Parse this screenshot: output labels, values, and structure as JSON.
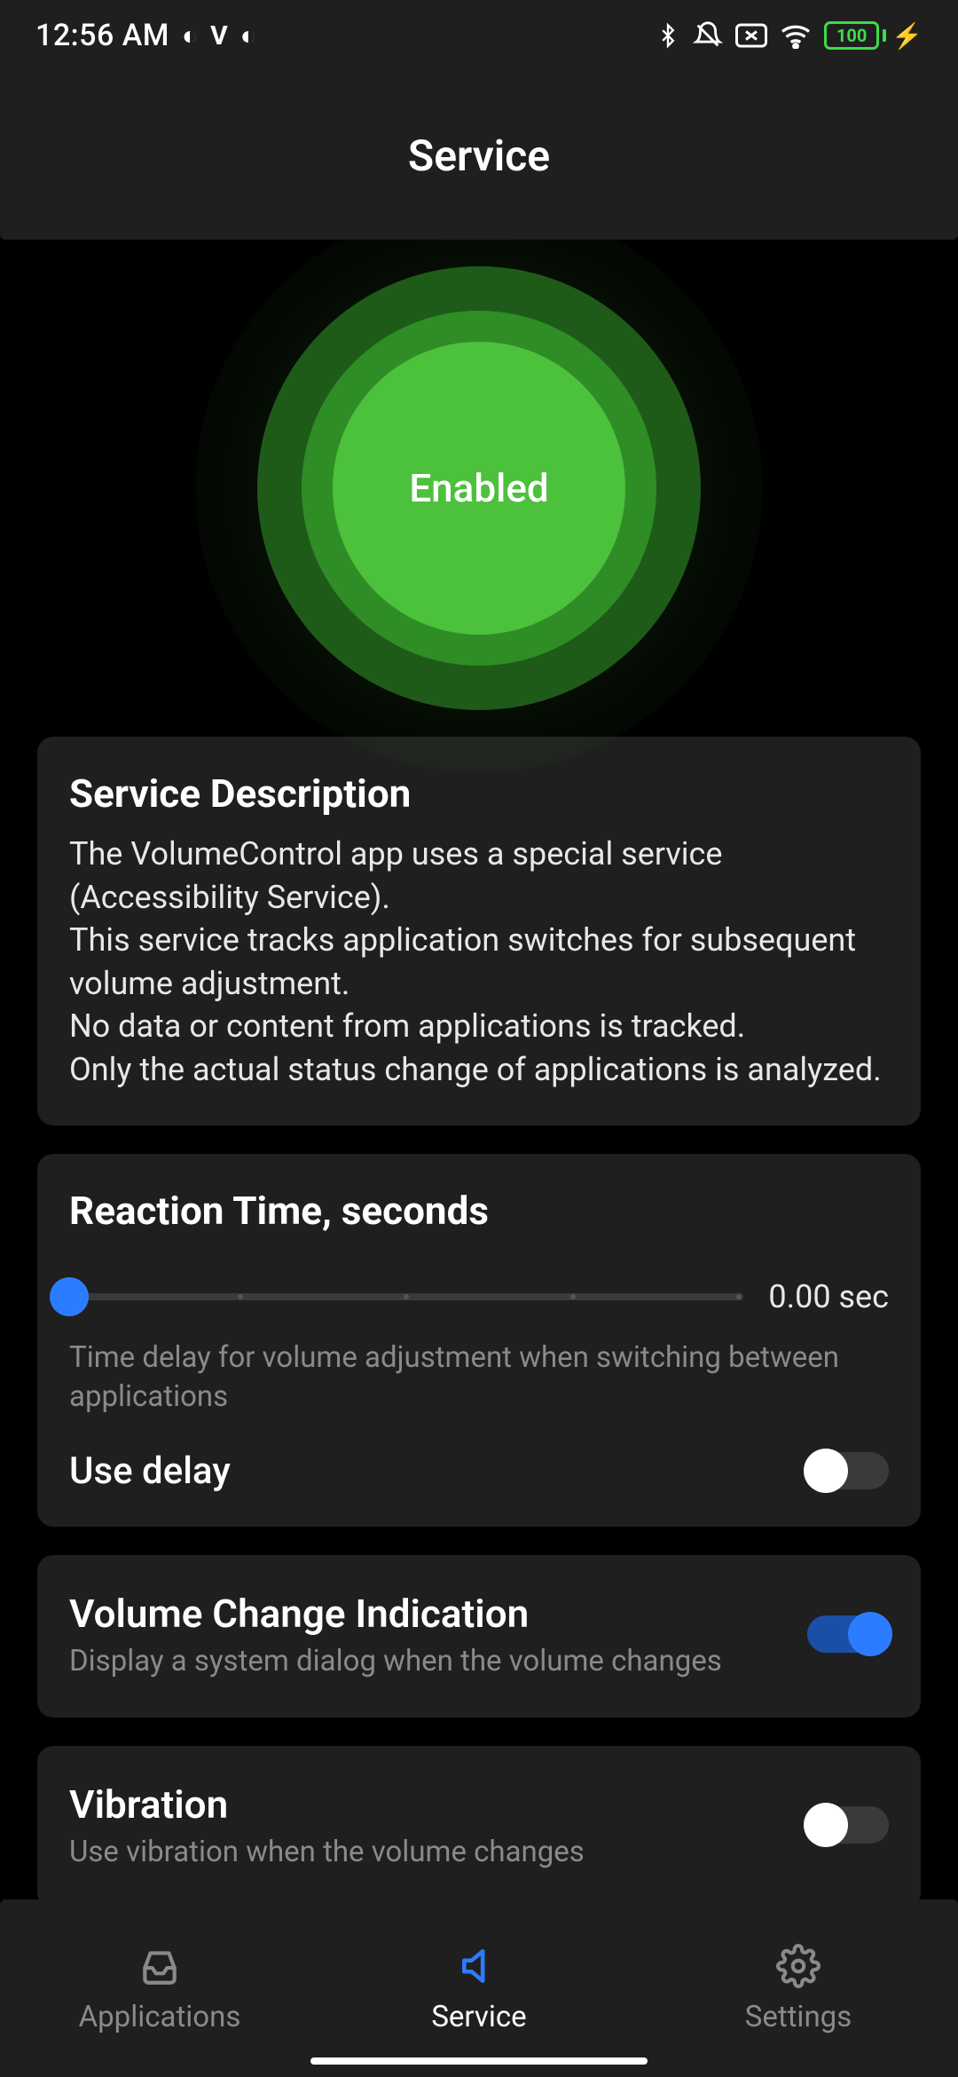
{
  "status": {
    "time": "12:56 AM",
    "battery": "100"
  },
  "header": {
    "title": "Service"
  },
  "orb": {
    "label": "Enabled"
  },
  "description": {
    "title": "Service Description",
    "body": "The VolumeControl app uses a special service (Accessibility Service).\nThis service tracks application switches for subsequent volume adjustment.\nNo data or content from applications is tracked.\nOnly the actual status change of applications is analyzed."
  },
  "reaction": {
    "title": "Reaction Time, seconds",
    "value_label": "0.00 sec",
    "description": "Time delay for volume adjustment when switching between applications",
    "use_delay_label": "Use delay",
    "use_delay_on": false
  },
  "volume_indication": {
    "title": "Volume Change Indication",
    "sub": "Display a system dialog when the volume changes",
    "on": true
  },
  "vibration": {
    "title": "Vibration",
    "sub": "Use vibration when the volume changes",
    "on": false
  },
  "nav": {
    "applications": "Applications",
    "service": "Service",
    "settings": "Settings",
    "active": "service"
  }
}
